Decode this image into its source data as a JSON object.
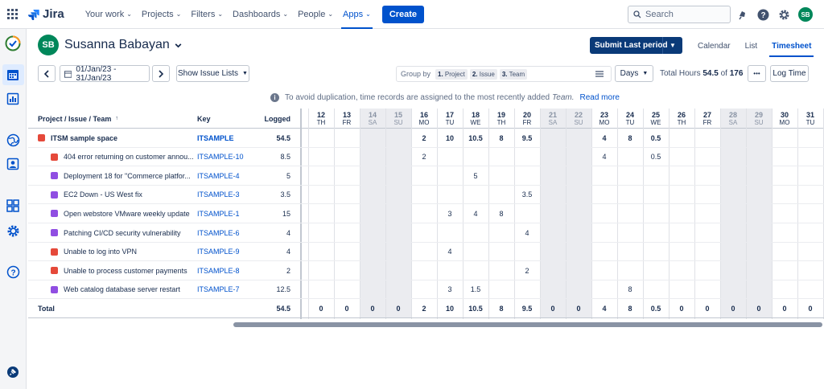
{
  "nav": {
    "app": "Jira",
    "items": [
      "Your work",
      "Projects",
      "Filters",
      "Dashboards",
      "People",
      "Apps"
    ],
    "active": "Apps",
    "create": "Create",
    "search_placeholder": "Search",
    "avatar": "SB"
  },
  "header": {
    "initials": "SB",
    "name": "Susanna Babayan",
    "submit": "Submit Last period",
    "views": [
      "Calendar",
      "List",
      "Timesheet"
    ],
    "active_view": "Timesheet"
  },
  "toolbar": {
    "date_range": "01/Jan/23 - 31/Jan/23",
    "issue_lists": "Show Issue Lists",
    "group_by": "Group by",
    "chips": [
      {
        "n": "1.",
        "l": "Project"
      },
      {
        "n": "2.",
        "l": "Issue"
      },
      {
        "n": "3.",
        "l": "Team"
      }
    ],
    "days": "Days",
    "total_label": "Total Hours",
    "total": "54.5",
    "of": "of",
    "capacity": "176",
    "more": "•••",
    "log_time": "Log Time"
  },
  "notice": {
    "text": "To avoid duplication, time records are assigned to the most recently added",
    "team": "Team.",
    "link": "Read more"
  },
  "table": {
    "headers": {
      "issue": "Project / Issue / Team",
      "key": "Key",
      "logged": "Logged"
    },
    "days": [
      {
        "d": "12",
        "w": "TH"
      },
      {
        "d": "13",
        "w": "FR"
      },
      {
        "d": "14",
        "w": "SA",
        "we": true
      },
      {
        "d": "15",
        "w": "SU",
        "we": true
      },
      {
        "d": "16",
        "w": "MO"
      },
      {
        "d": "17",
        "w": "TU"
      },
      {
        "d": "18",
        "w": "WE"
      },
      {
        "d": "19",
        "w": "TH"
      },
      {
        "d": "20",
        "w": "FR"
      },
      {
        "d": "21",
        "w": "SA",
        "we": true
      },
      {
        "d": "22",
        "w": "SU",
        "we": true
      },
      {
        "d": "23",
        "w": "MO"
      },
      {
        "d": "24",
        "w": "TU"
      },
      {
        "d": "25",
        "w": "WE"
      },
      {
        "d": "26",
        "w": "TH"
      },
      {
        "d": "27",
        "w": "FR"
      },
      {
        "d": "28",
        "w": "SA",
        "we": true
      },
      {
        "d": "29",
        "w": "SU",
        "we": true
      },
      {
        "d": "30",
        "w": "MO"
      },
      {
        "d": "31",
        "w": "TU"
      }
    ],
    "rows": [
      {
        "title": "ITSM sample space",
        "key": "ITSAMPLE",
        "logged": "54.5",
        "type": "project",
        "vals": [
          "",
          "",
          "",
          "",
          "2",
          "10",
          "10.5",
          "8",
          "9.5",
          "",
          "",
          "4",
          "8",
          "0.5",
          "",
          "",
          "",
          "",
          "",
          ""
        ]
      },
      {
        "title": "404 error returning on customer annou...",
        "key": "ITSAMPLE-10",
        "logged": "8.5",
        "type": "bug",
        "vals": [
          "",
          "",
          "",
          "",
          "2",
          "",
          "",
          "",
          "",
          "",
          "",
          "4",
          "",
          "0.5",
          "",
          "",
          "",
          "",
          "",
          ""
        ]
      },
      {
        "title": "Deployment 18 for \"Commerce platfor...",
        "key": "ITSAMPLE-4",
        "logged": "5",
        "type": "task",
        "vals": [
          "",
          "",
          "",
          "",
          "",
          "",
          "5",
          "",
          "",
          "",
          "",
          "",
          "",
          "",
          "",
          "",
          "",
          "",
          "",
          ""
        ]
      },
      {
        "title": "EC2 Down - US West fix",
        "key": "ITSAMPLE-3",
        "logged": "3.5",
        "type": "task",
        "vals": [
          "",
          "",
          "",
          "",
          "",
          "",
          "",
          "",
          "3.5",
          "",
          "",
          "",
          "",
          "",
          "",
          "",
          "",
          "",
          "",
          ""
        ]
      },
      {
        "title": "Open webstore VMware weekly update",
        "key": "ITSAMPLE-1",
        "logged": "15",
        "type": "task",
        "vals": [
          "",
          "",
          "",
          "",
          "",
          "3",
          "4",
          "8",
          "",
          "",
          "",
          "",
          "",
          "",
          "",
          "",
          "",
          "",
          "",
          ""
        ]
      },
      {
        "title": "Patching CI/CD security vulnerability",
        "key": "ITSAMPLE-6",
        "logged": "4",
        "type": "task",
        "vals": [
          "",
          "",
          "",
          "",
          "",
          "",
          "",
          "",
          "4",
          "",
          "",
          "",
          "",
          "",
          "",
          "",
          "",
          "",
          "",
          ""
        ]
      },
      {
        "title": "Unable to log into VPN",
        "key": "ITSAMPLE-9",
        "logged": "4",
        "type": "bug",
        "vals": [
          "",
          "",
          "",
          "",
          "",
          "4",
          "",
          "",
          "",
          "",
          "",
          "",
          "",
          "",
          "",
          "",
          "",
          "",
          "",
          ""
        ]
      },
      {
        "title": "Unable to process customer payments",
        "key": "ITSAMPLE-8",
        "logged": "2",
        "type": "bug",
        "vals": [
          "",
          "",
          "",
          "",
          "",
          "",
          "",
          "",
          "2",
          "",
          "",
          "",
          "",
          "",
          "",
          "",
          "",
          "",
          "",
          ""
        ]
      },
      {
        "title": "Web catalog database server restart",
        "key": "ITSAMPLE-7",
        "logged": "12.5",
        "type": "task",
        "vals": [
          "",
          "",
          "",
          "",
          "",
          "3",
          "1.5",
          "",
          "",
          "",
          "",
          "",
          "8",
          "",
          "",
          "",
          "",
          "",
          "",
          ""
        ]
      }
    ],
    "total": {
      "label": "Total",
      "logged": "54.5",
      "vals": [
        "0",
        "0",
        "0",
        "0",
        "2",
        "10",
        "10.5",
        "8",
        "9.5",
        "0",
        "0",
        "4",
        "8",
        "0.5",
        "0",
        "0",
        "0",
        "0",
        "0",
        "0"
      ]
    }
  },
  "colors": {
    "accent": "#0052cc",
    "bug": "#e5493a",
    "task": "#904ee2",
    "project": "#e5493a"
  }
}
